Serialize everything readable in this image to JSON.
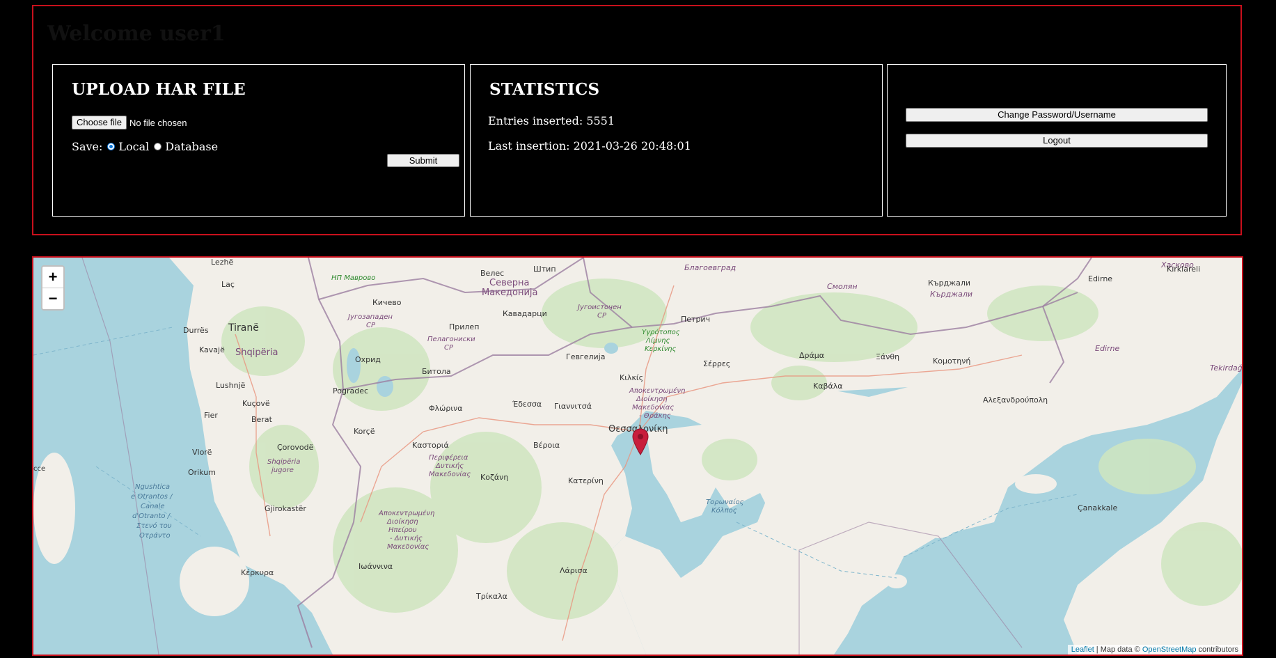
{
  "header": {
    "welcome": "Welcome user1"
  },
  "upload": {
    "title": "UPLOAD HAR FILE",
    "choose_file_label": "Choose file",
    "file_status": "No file chosen",
    "save_label": "Save:",
    "options": [
      {
        "label": "Local",
        "checked": true
      },
      {
        "label": "Database",
        "checked": false
      }
    ],
    "submit_label": "Submit"
  },
  "statistics": {
    "title": "STATISTICS",
    "entries_line": "Entries inserted: 5551",
    "last_line": "Last insertion: 2021-03-26 20:48:01"
  },
  "account": {
    "change_label": "Change Password/Username",
    "logout_label": "Logout"
  },
  "map": {
    "zoom_in": "+",
    "zoom_out": "−",
    "attribution": {
      "leaflet": "Leaflet",
      "sep": " | Map data © ",
      "osm": "OpenStreetMap",
      "suffix": " contributors"
    },
    "marker_color": "#c81e3c",
    "labels": {
      "lezhe": "Lezhë",
      "lac": "Laç",
      "tirane": "Tiranë",
      "durres": "Durrës",
      "kavaje": "Kavajë",
      "shqiperia": "Shqipëria",
      "lushnje": "Lushnjë",
      "kucove": "Kuçovë",
      "fier": "Fier",
      "berat": "Berat",
      "vlore": "Vlorë",
      "corovode": "Çorovodë",
      "orikum": "Orikum",
      "gjirokaster": "Gjirokastër",
      "korce": "Korçë",
      "pogradec": "Pogradec",
      "ohrid": "Охрид",
      "bitola": "Битола",
      "prilep": "Прилеп",
      "kicevo": "Кичево",
      "veles": "Велес",
      "stip": "Штип",
      "kavadarci": "Кавадарци",
      "makedonija_1": "Северна",
      "makedonija_2": "Македонија",
      "gevgelija": "Гевгелија",
      "petric": "Петрич",
      "blagoevgrad": "Благоевград",
      "smolyan": "Смолян",
      "kardzhali": "Кърджали",
      "kardzhali_it": "Кърджали",
      "haskovo": "Хасково",
      "kirklareli": "Kırklareli",
      "edirne": "Edirne",
      "edirne_it": "Edirne",
      "tekirdag": "Tekirdağ",
      "kilkis": "Κιλκίς",
      "serres": "Σέρρες",
      "drama": "Δράμα",
      "xanthi": "Ξάνθη",
      "komotini": "Κομοτηνή",
      "kavala": "Καβάλα",
      "alexandroupoli": "Αλεξανδρούπολη",
      "thessaloniki": "Θεσσαλονίκη",
      "edessa": "Έδεσσα",
      "giannitsa": "Γιαννιτσά",
      "florina": "Φλώρινα",
      "kastoria": "Καστοριά",
      "veria": "Βέροια",
      "kozani": "Κοζάνη",
      "katerini": "Κατερίνη",
      "larisa": "Λάρισα",
      "trikala": "Τρίκαλα",
      "ioannina": "Ιωάννινα",
      "kerkyra": "Κέρκυρα",
      "canakkale": "Çanakkale",
      "toronaios_1": "Τορωναίος",
      "toronaios_2": "Κόλπος",
      "np_mavrovo": "НП Маврово",
      "jugozapaden_1": "Југозападен",
      "jugozapaden_2": "СР",
      "pelagoniski_1": "Пелагониски",
      "pelagoniski_2": "СР",
      "jugoistocen_1": "Југоисточен",
      "jugoistocen_2": "СР",
      "ygrotopos_1": "Υγρότοπος",
      "ygrotopos_2": "Λίμνης",
      "ygrotopos_3": "Κερκίνης",
      "shqiperia_jug_1": "Shqipëria",
      "shqiperia_jug_2": "jugore",
      "apok_mak_1": "Αποκεντρωμένη",
      "apok_mak_2": "Διοίκηση",
      "apok_mak_3": "Μακεδονίας",
      "apok_mak_4": "- Θράκης",
      "periferia_1": "Περιφέρεια",
      "periferia_2": "Δυτικής",
      "periferia_3": "Μακεδονίας",
      "apok_ip_1": "Αποκεντρωμένη",
      "apok_ip_2": "Διοίκηση",
      "apok_ip_3": "Ηπείρου",
      "apok_ip_4": "- Δυτικής",
      "apok_ip_5": "Μακεδονίας",
      "otranto_1": "Ngushtica",
      "otranto_2": "e Otrantos /",
      "otranto_3": "Canale",
      "otranto_4": "d'Otranto /",
      "otranto_5": "Στενό του",
      "otranto_6": "Οτράντο",
      "cce": "cce"
    }
  }
}
